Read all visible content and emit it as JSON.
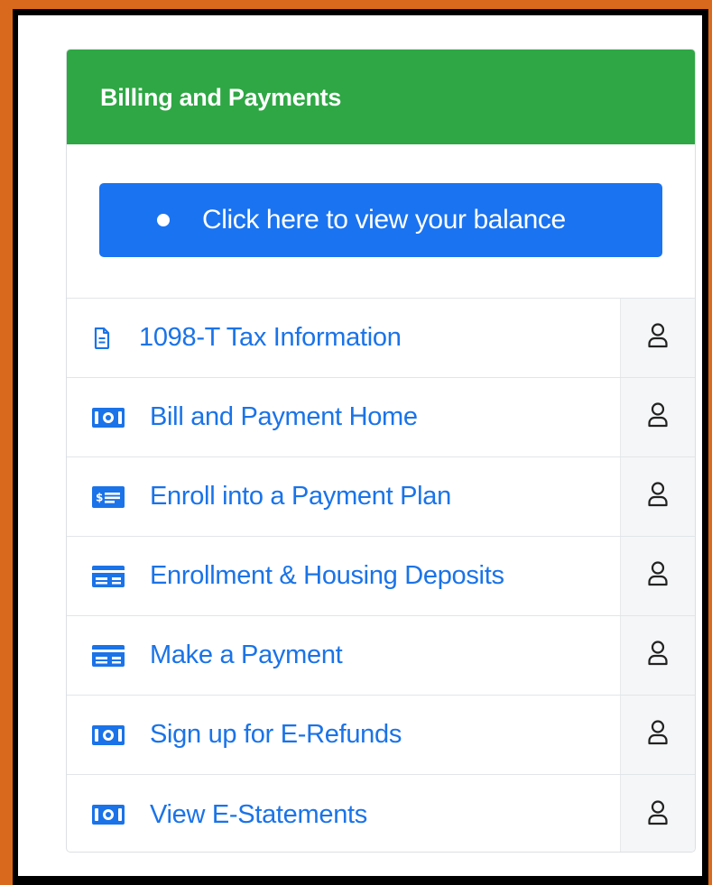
{
  "card": {
    "title": "Billing and Payments",
    "header_color": "#2ea744"
  },
  "balance_button": {
    "label": "Click here to view your balance",
    "color": "#1a73f0"
  },
  "links": [
    {
      "label": "1098-T Tax Information",
      "icon": "document-icon"
    },
    {
      "label": "Bill and Payment Home",
      "icon": "money-icon"
    },
    {
      "label": "Enroll into a Payment Plan",
      "icon": "money-check-icon"
    },
    {
      "label": "Enrollment & Housing Deposits",
      "icon": "credit-card-icon"
    },
    {
      "label": "Make a Payment",
      "icon": "credit-card-icon"
    },
    {
      "label": "Sign up for E-Refunds",
      "icon": "money-icon"
    },
    {
      "label": "View E-Statements",
      "icon": "money-icon"
    }
  ],
  "row_action_icon": "user-icon",
  "colors": {
    "frame_border": "#d9691c",
    "link_text": "#1a73e8",
    "action_bg": "#f5f6f7"
  }
}
